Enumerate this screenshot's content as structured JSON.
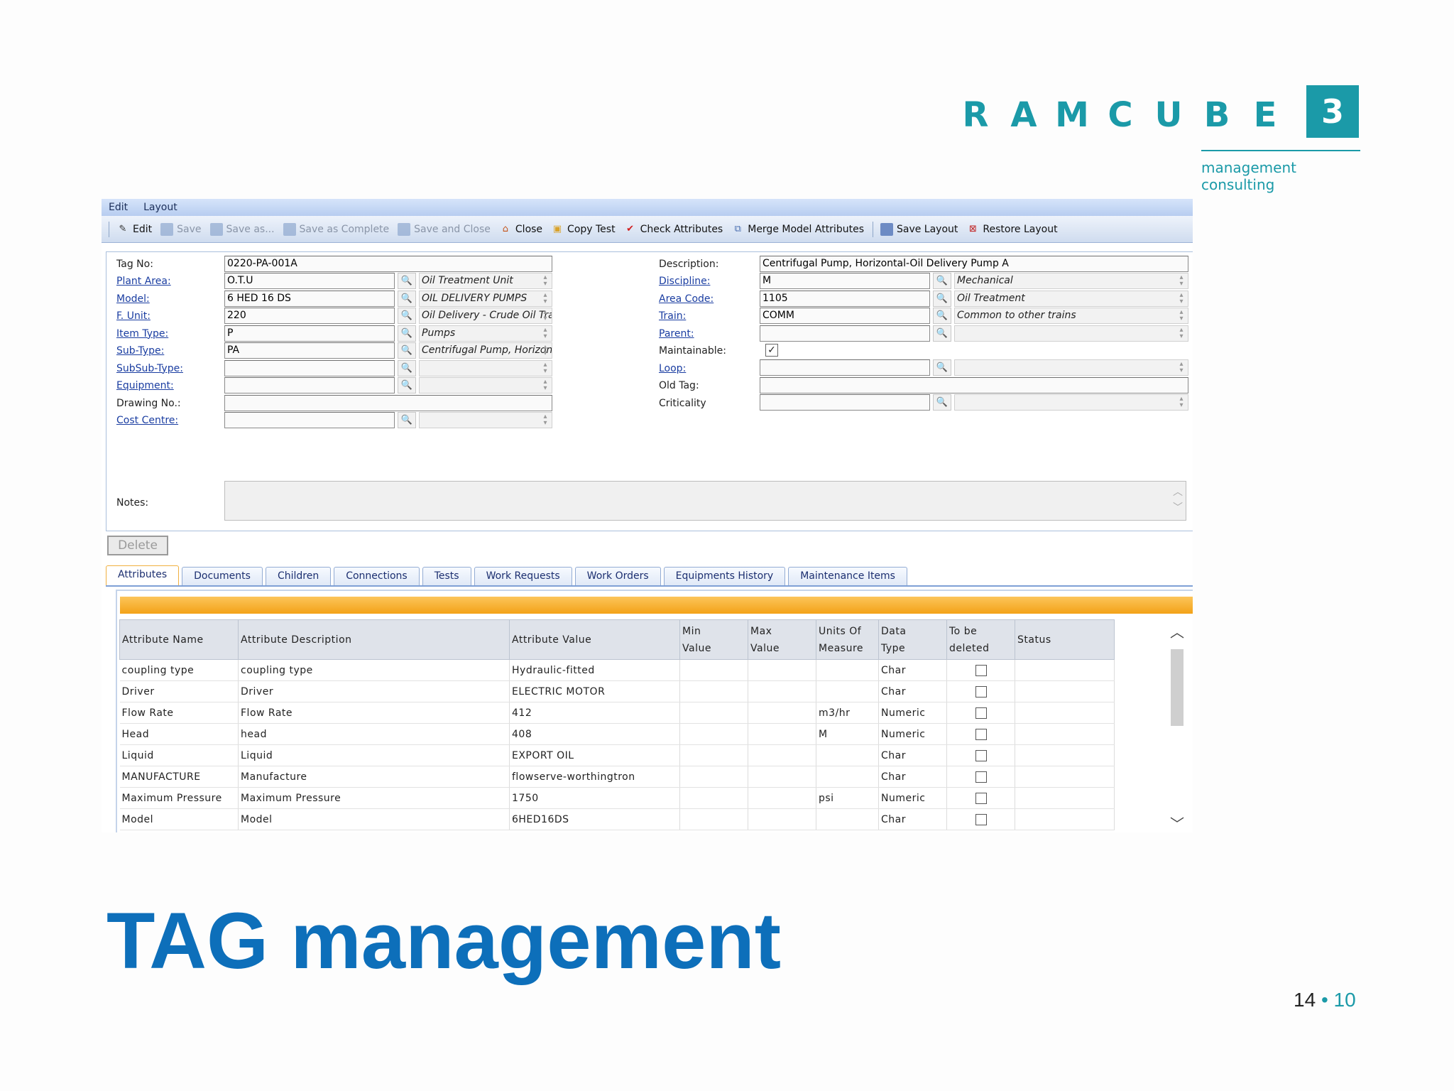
{
  "logo": {
    "letters": [
      "R",
      "A",
      "M",
      "C",
      "U",
      "B",
      "E"
    ],
    "box": "3",
    "tagline": "management consulting"
  },
  "menu": [
    "Edit",
    "Layout"
  ],
  "toolbar": [
    {
      "label": "Edit",
      "icon": "pencil-icon",
      "enabled": true
    },
    {
      "label": "Save",
      "icon": "save-icon",
      "enabled": false
    },
    {
      "label": "Save as...",
      "icon": "save-as-icon",
      "enabled": false
    },
    {
      "label": "Save as Complete",
      "icon": "save-complete-icon",
      "enabled": false
    },
    {
      "label": "Save and Close",
      "icon": "save-close-icon",
      "enabled": false
    },
    {
      "label": "Close",
      "icon": "home-icon",
      "enabled": true
    },
    {
      "label": "Copy Test",
      "icon": "folder-copy-icon",
      "enabled": true
    },
    {
      "label": "Check Attributes",
      "icon": "checkmark-icon",
      "enabled": true
    },
    {
      "label": "Merge Model Attributes",
      "icon": "merge-icon",
      "enabled": true
    },
    {
      "label": "Save Layout",
      "icon": "save-layout-icon",
      "enabled": true
    },
    {
      "label": "Restore Layout",
      "icon": "restore-layout-icon",
      "enabled": true
    }
  ],
  "form": {
    "tag_no": {
      "label": "Tag No:",
      "value": "0220-PA-001A"
    },
    "description": {
      "label": "Description:",
      "value": "Centrifugal Pump, Horizontal-Oil Delivery Pump A"
    },
    "left": [
      {
        "label": "Plant Area:",
        "code": "O.T.U",
        "desc": "Oil Treatment Unit"
      },
      {
        "label": "Model:",
        "code": "6 HED 16 DS",
        "desc": "OIL DELIVERY PUMPS"
      },
      {
        "label": "F. Unit:",
        "code": "220",
        "desc": "Oil Delivery - Crude Oil Transport and"
      },
      {
        "label": "Item Type:",
        "code": "P",
        "desc": "Pumps"
      },
      {
        "label": "Sub-Type:",
        "code": "PA",
        "desc": "Centrifugal Pump, Horizontal"
      },
      {
        "label": "SubSub-Type:",
        "code": "",
        "desc": ""
      },
      {
        "label": "Equipment:",
        "code": "",
        "desc": ""
      }
    ],
    "drawing_no": {
      "label": "Drawing No.:",
      "value": ""
    },
    "cost_centre": {
      "label": "Cost Centre:",
      "code": "",
      "desc": ""
    },
    "right": [
      {
        "label": "Discipline:",
        "code": "M",
        "desc": "Mechanical"
      },
      {
        "label": "Area Code:",
        "code": "1105",
        "desc": "Oil Treatment"
      },
      {
        "label": "Train:",
        "code": "COMM",
        "desc": "Common to other trains"
      },
      {
        "label": "Parent:",
        "code": "",
        "desc": ""
      }
    ],
    "maintainable": {
      "label": "Maintainable:",
      "checked": true,
      "mark": "✓"
    },
    "loop": {
      "label": "Loop:",
      "code": "",
      "desc": ""
    },
    "old_tag": {
      "label": "Old Tag:",
      "value": ""
    },
    "criticality": {
      "label": "Criticality",
      "code": "",
      "desc": ""
    },
    "notes": {
      "label": "Notes:",
      "value": ""
    }
  },
  "delete_label": "Delete",
  "tabs": [
    "Attributes",
    "Documents",
    "Children",
    "Connections",
    "Tests",
    "Work Requests",
    "Work Orders",
    "Equipments History",
    "Maintenance Items"
  ],
  "grid": {
    "headers": [
      "Attribute Name",
      "Attribute Description",
      "Attribute Value",
      "Min Value",
      "Max Value",
      "Units Of Measure",
      "Data Type",
      "To be deleted",
      "Status"
    ],
    "header_lines": [
      [
        "Attribute Name"
      ],
      [
        "Attribute Description"
      ],
      [
        "Attribute Value"
      ],
      [
        "Min",
        "Value"
      ],
      [
        "Max",
        "Value"
      ],
      [
        "Units Of",
        "Measure"
      ],
      [
        "Data",
        "Type"
      ],
      [
        "To be",
        "deleted"
      ],
      [
        "Status"
      ]
    ],
    "rows": [
      [
        "coupling type",
        "coupling type",
        "Hydraulic-fitted",
        "",
        "",
        "",
        "Char",
        false,
        ""
      ],
      [
        "Driver",
        "Driver",
        "ELECTRIC MOTOR",
        "",
        "",
        "",
        "Char",
        false,
        ""
      ],
      [
        "Flow Rate",
        "Flow Rate",
        "412",
        "",
        "",
        "m3/hr",
        "Numeric",
        false,
        ""
      ],
      [
        "Head",
        "head",
        "408",
        "",
        "",
        "M",
        "Numeric",
        false,
        ""
      ],
      [
        "Liquid",
        "Liquid",
        "EXPORT OIL",
        "",
        "",
        "",
        "Char",
        false,
        ""
      ],
      [
        "MANUFACTURE",
        "Manufacture",
        "flowserve-worthingtron",
        "",
        "",
        "",
        "Char",
        false,
        ""
      ],
      [
        "Maximum Pressure",
        "Maximum Pressure",
        "1750",
        "",
        "",
        "psi",
        "Numeric",
        false,
        ""
      ],
      [
        "Model",
        "Model",
        "6HED16DS",
        "",
        "",
        "",
        "Char",
        false,
        ""
      ]
    ]
  },
  "slide_title": "TAG management",
  "page_number": {
    "section": "14",
    "sep": "•",
    "page": "10"
  },
  "colors": {
    "brand_teal": "#1b9aa8",
    "title_blue": "#0d6fba",
    "grid_header_bar": "#f3a218"
  }
}
